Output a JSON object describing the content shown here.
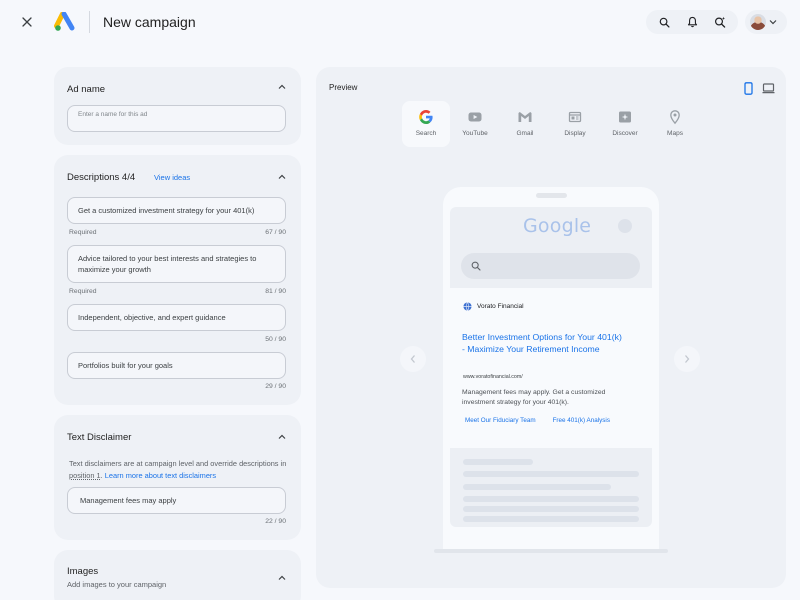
{
  "header": {
    "title": "New campaign"
  },
  "ad_name": {
    "title": "Ad name",
    "placeholder": "Enter a name for this ad"
  },
  "descriptions": {
    "title": "Descriptions 4/4",
    "view_ideas": "View ideas",
    "items": [
      {
        "text": "Get a customized investment strategy for your 401(k)",
        "helper": "Required",
        "count": "67 / 90"
      },
      {
        "text": "Advice tailored to your best interests and strategies to maximize your growth",
        "helper": "Required",
        "count": "81 / 90"
      },
      {
        "text": "Independent, objective, and expert guidance",
        "helper": "",
        "count": "50 / 90"
      },
      {
        "text": "Portfolios built for your goals",
        "helper": "",
        "count": "29 / 90"
      }
    ]
  },
  "text_disclaimer": {
    "title": "Text Disclaimer",
    "info_part1": "Text disclaimers are at campaign level and override descriptions in ",
    "info_position": "position 1",
    "info_period": ".",
    "learn_more": "Learn more about text disclaimers",
    "value": "Management fees may apply",
    "count": "22 / 90"
  },
  "images": {
    "title": "Images",
    "subtitle": "Add images to your campaign"
  },
  "preview": {
    "label": "Preview",
    "channels": [
      {
        "label": "Search",
        "icon": "google-g-icon",
        "active": true
      },
      {
        "label": "YouTube",
        "icon": "youtube-icon",
        "active": false
      },
      {
        "label": "Gmail",
        "icon": "gmail-icon",
        "active": false
      },
      {
        "label": "Display",
        "icon": "display-icon",
        "active": false
      },
      {
        "label": "Discover",
        "icon": "discover-icon",
        "active": false
      },
      {
        "label": "Maps",
        "icon": "maps-pin-icon",
        "active": false
      }
    ],
    "phone": {
      "search_logo": "Google",
      "ad": {
        "advertiser": "Vorato Financial",
        "headline": "Better Investment Options for Your 401(k) - Maximize Your Retirement Income",
        "url": "www.voratofinancial.com/",
        "description": "Management fees may apply. Get a customized investment strategy for your 401(k).",
        "sitelinks": [
          "Meet Our Fiduciary Team",
          "Free 401(k) Analysis"
        ]
      }
    }
  },
  "colors": {
    "accent": "#1a73e8",
    "page_bg": "#f6f8fc",
    "card_bg": "#eef1f6"
  }
}
